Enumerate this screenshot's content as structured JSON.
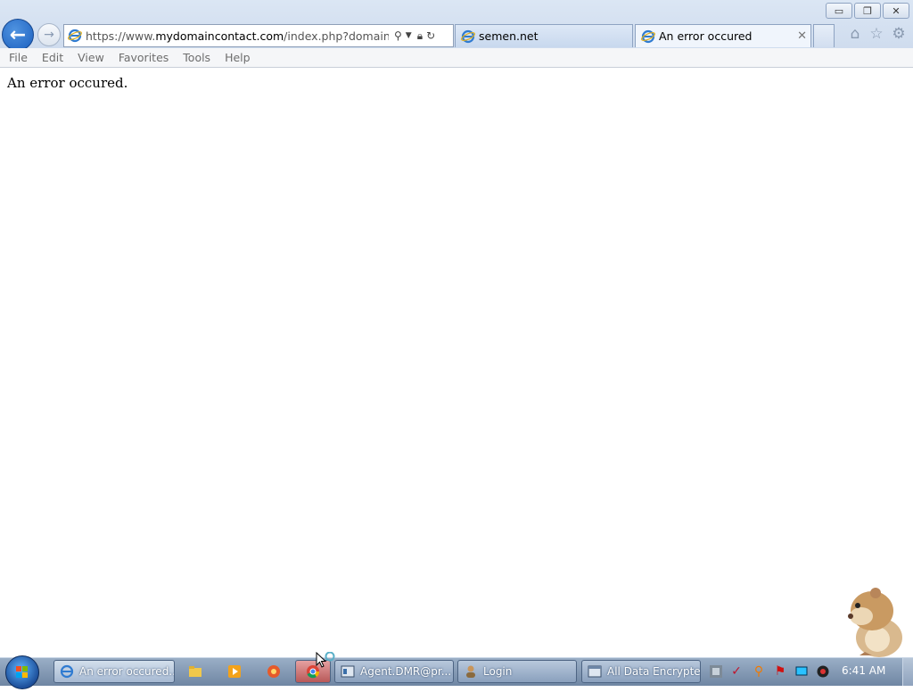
{
  "window": {
    "minimize_glyph": "▭",
    "maximize_glyph": "❐",
    "close_glyph": "✕"
  },
  "nav": {
    "back_glyph": "←",
    "forward_glyph": "→"
  },
  "address": {
    "url_prefix": "https://www.",
    "url_domain": "mydomaincontact.com",
    "url_rest": "/index.php?domain_name="
  },
  "tabs": [
    {
      "label": "semen.net",
      "active": false
    },
    {
      "label": "An error occured",
      "active": true
    }
  ],
  "tab_close_glyph": "✕",
  "menu": [
    "File",
    "Edit",
    "View",
    "Favorites",
    "Tools",
    "Help"
  ],
  "page": {
    "message": "An error occured."
  },
  "taskbar": {
    "items": [
      {
        "label": "An error occured..."
      },
      {
        "label": "Agent.DMR@pr..."
      },
      {
        "label": "Login"
      },
      {
        "label": "All Data Encrypted"
      }
    ],
    "clock": "6:41 AM"
  },
  "colors": {
    "accent": "#1b5fbf",
    "taskbar": "#7f95b1",
    "chrome": "#d6e2f1"
  }
}
